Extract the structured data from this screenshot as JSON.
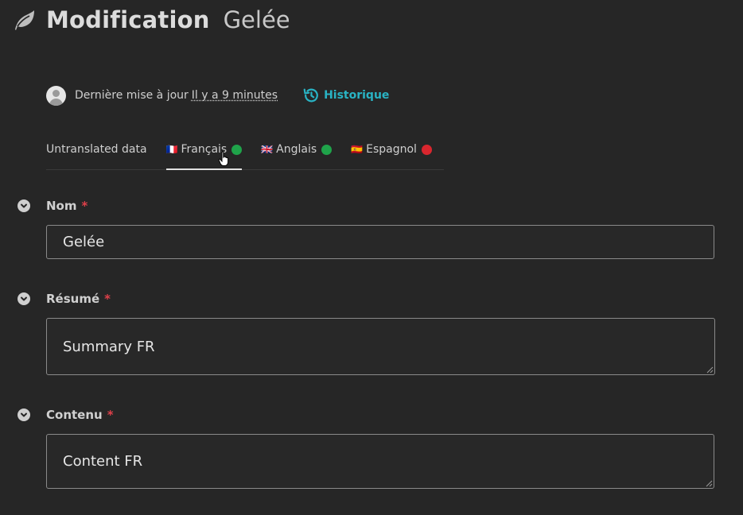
{
  "header": {
    "title": "Modification",
    "subtitle": "Gelée",
    "icon": "leaf-icon"
  },
  "meta": {
    "last_update_label": "Dernière mise à jour",
    "last_update_time": "Il y a 9  minutes",
    "history_label": "Historique",
    "history_icon": "history-icon",
    "accent_color": "#29b3c4"
  },
  "tabs": [
    {
      "label": "Untranslated data",
      "flag": "",
      "status": ""
    },
    {
      "label": "Français",
      "flag": "🇫🇷",
      "status": "complete",
      "active": true
    },
    {
      "label": "Anglais",
      "flag": "🇬🇧",
      "status": "complete"
    },
    {
      "label": "Espagnol",
      "flag": "🇪🇸",
      "status": "missing"
    }
  ],
  "status_colors": {
    "complete": "#1fa34a",
    "missing": "#d9262e"
  },
  "fields": {
    "nom": {
      "label": "Nom",
      "required_mark": "*",
      "value": "Gelée"
    },
    "resume": {
      "label": "Résumé",
      "required_mark": "*",
      "value": "Summary FR"
    },
    "contenu": {
      "label": "Contenu",
      "required_mark": "*",
      "value": "Content FR"
    }
  }
}
